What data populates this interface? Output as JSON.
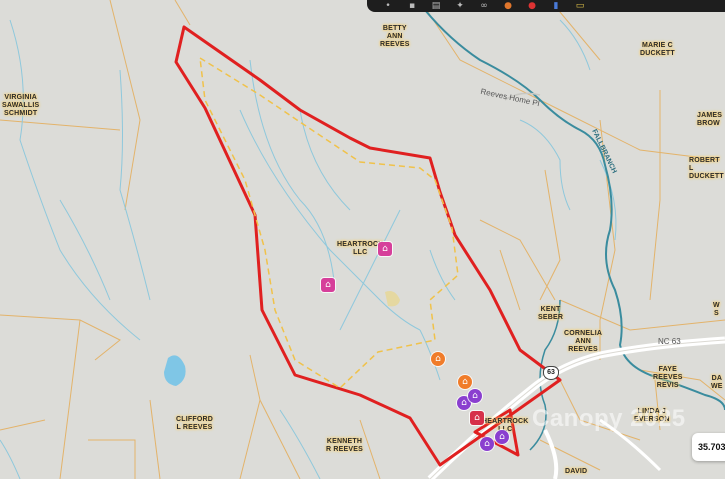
{
  "owners": [
    {
      "id": "betty-ann-reeves",
      "text": "BETTY\nANN\nREEVES"
    },
    {
      "id": "marie-c-duckett",
      "text": "MARIE C\nDUCKETT"
    },
    {
      "id": "virginia-sawallis-schmidt",
      "text": "VIRGINIA\nSAWALLIS\nSCHMIDT"
    },
    {
      "id": "james-brow",
      "text": "JAMES\nBROW"
    },
    {
      "id": "robert-duckett",
      "text": "ROBERT L\nDUCKETT"
    },
    {
      "id": "heartrock-llc",
      "text": "HEARTROCK\nLLC"
    },
    {
      "id": "kent-seber",
      "text": "KENT\nSEBER"
    },
    {
      "id": "w-s",
      "text": "W\nS"
    },
    {
      "id": "cornelia-ann-reeves",
      "text": "CORNELIA\nANN\nREEVES"
    },
    {
      "id": "faye-reeves-revis",
      "text": "FAYE\nREEVES\nREVIS"
    },
    {
      "id": "da-we",
      "text": "DA\nWE"
    },
    {
      "id": "linda-everson",
      "text": "LINDA J\nEVERSON"
    },
    {
      "id": "clifford-reeves",
      "text": "CLIFFORD\nL REEVES"
    },
    {
      "id": "kenneth-reeves",
      "text": "KENNETH\nR REEVES"
    },
    {
      "id": "heartrock-llc-2",
      "text": "HEARTROCK\nLLC"
    },
    {
      "id": "david",
      "text": "DAVID"
    }
  ],
  "roads": {
    "reeves_home_pl": "Reeves Home Pl",
    "fallbranch": "FALLBRANCH",
    "nc63": "NC 63",
    "shield_63": "63"
  },
  "coordinates": "35.703",
  "watermark": "Canopy 2025",
  "markers": [
    {
      "id": "farm-1",
      "icon": "farm-icon",
      "color": "#d63f9a",
      "glyph": "⌂"
    },
    {
      "id": "farm-2",
      "icon": "farm-icon",
      "color": "#d63f9a",
      "glyph": "⌂"
    },
    {
      "id": "house-1",
      "icon": "house-icon",
      "color": "#f07c2a",
      "glyph": "⌂"
    },
    {
      "id": "house-2",
      "icon": "house-icon",
      "color": "#f07c2a",
      "glyph": "⌂"
    },
    {
      "id": "home-1",
      "icon": "home-icon",
      "color": "#8a3fcf",
      "glyph": "⌂"
    },
    {
      "id": "home-2",
      "icon": "home-icon",
      "color": "#8a3fcf",
      "glyph": "⌂"
    },
    {
      "id": "home-3",
      "icon": "home-icon",
      "color": "#8a3fcf",
      "glyph": "⌂"
    },
    {
      "id": "home-4",
      "icon": "home-icon",
      "color": "#8a3fcf",
      "glyph": "⌂"
    },
    {
      "id": "barn-1",
      "icon": "barn-icon",
      "color": "#d6304a",
      "glyph": "⌂"
    }
  ],
  "toolbar": [
    {
      "icon": "pin-icon",
      "glyph": "•"
    },
    {
      "icon": "square-icon",
      "glyph": "▪"
    },
    {
      "icon": "layers-icon",
      "glyph": "▤"
    },
    {
      "icon": "route-icon",
      "glyph": "✦"
    },
    {
      "icon": "link-icon",
      "glyph": "∞"
    },
    {
      "icon": "circle-orange-icon",
      "glyph": "●"
    },
    {
      "icon": "circle-red-icon",
      "glyph": "●"
    },
    {
      "icon": "doc-icon",
      "glyph": "▮"
    },
    {
      "icon": "folder-icon",
      "glyph": "▭"
    }
  ],
  "colors": {
    "parcel_outline": "#e02020",
    "dashed_boundary": "#f0c24a",
    "streams": "#8ec8dc",
    "river": "#3a8c9e",
    "lot_lines": "#e3b36a",
    "background": "#dcdcd8"
  }
}
